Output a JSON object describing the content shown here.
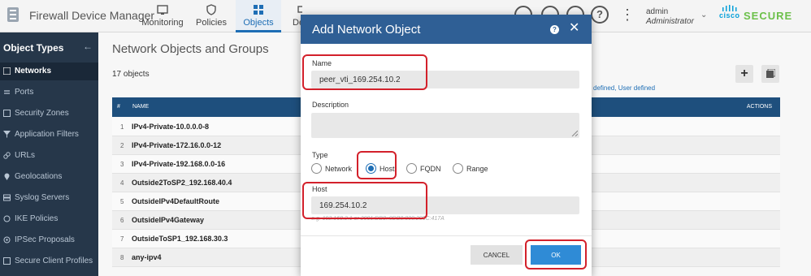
{
  "header": {
    "app_title": "Firewall Device Manager",
    "nav": [
      {
        "label": "Monitoring",
        "icon": "monitoring-icon"
      },
      {
        "label": "Policies",
        "icon": "policies-icon"
      },
      {
        "label": "Objects",
        "icon": "objects-icon",
        "active": true
      },
      {
        "label": "De",
        "icon": "device-icon"
      }
    ],
    "icons": [
      "deploy-icon",
      "upload-icon",
      "terminal-icon",
      "help-icon"
    ],
    "help_glyph": "?",
    "kebab_glyph": "⋮",
    "user": {
      "name": "admin",
      "role": "Administrator"
    },
    "brand": {
      "cisco": "cisco",
      "secure": "SECURE"
    },
    "accent": "#1e6eb5"
  },
  "sidebar": {
    "title": "Object Types",
    "collapse_glyph": "←",
    "items": [
      {
        "label": "Networks",
        "icon": "network-icon",
        "active": true
      },
      {
        "label": "Ports",
        "icon": "ports-icon"
      },
      {
        "label": "Security Zones",
        "icon": "zone-icon"
      },
      {
        "label": "Application Filters",
        "icon": "filter-icon"
      },
      {
        "label": "URLs",
        "icon": "link-icon"
      },
      {
        "label": "Geolocations",
        "icon": "geolocation-icon"
      },
      {
        "label": "Syslog Servers",
        "icon": "syslog-icon"
      },
      {
        "label": "IKE Policies",
        "icon": "ike-icon"
      },
      {
        "label": "IPSec Proposals",
        "icon": "ipsec-icon"
      },
      {
        "label": "Secure Client Profiles",
        "icon": "profile-icon"
      }
    ]
  },
  "main": {
    "title": "Network Objects and Groups",
    "count": "17 objects",
    "filter_text": "defined, User defined",
    "add_glyph": "+",
    "table": {
      "headers": {
        "num": "#",
        "name": "NAME",
        "actions": "ACTIONS"
      },
      "rows": [
        {
          "num": "1",
          "name": "IPv4-Private-10.0.0.0-8"
        },
        {
          "num": "2",
          "name": "IPv4-Private-172.16.0.0-12"
        },
        {
          "num": "3",
          "name": "IPv4-Private-192.168.0.0-16"
        },
        {
          "num": "4",
          "name": "Outside2ToSP2_192.168.40.4"
        },
        {
          "num": "5",
          "name": "OutsideIPv4DefaultRoute"
        },
        {
          "num": "6",
          "name": "OutsideIPv4Gateway"
        },
        {
          "num": "7",
          "name": "OutsideToSP1_192.168.30.3"
        },
        {
          "num": "8",
          "name": "any-ipv4"
        }
      ]
    }
  },
  "modal": {
    "title": "Add Network Object",
    "help_glyph": "?",
    "close_glyph": "✕",
    "name_label": "Name",
    "name_value": "peer_vti_169.254.10.2",
    "description_label": "Description",
    "description_value": "",
    "type_label": "Type",
    "types": [
      {
        "label": "Network",
        "checked": false
      },
      {
        "label": "Host",
        "checked": true
      },
      {
        "label": "FQDN",
        "checked": false
      },
      {
        "label": "Range",
        "checked": false
      }
    ],
    "host_label": "Host",
    "host_value": "169.254.10.2",
    "host_hint": "e.g. 192.168.2.1 or 2001:DB8::0DB8:800:200C:417A",
    "cancel_label": "CANCEL",
    "ok_label": "OK",
    "annotation_color": "#d3212b"
  }
}
